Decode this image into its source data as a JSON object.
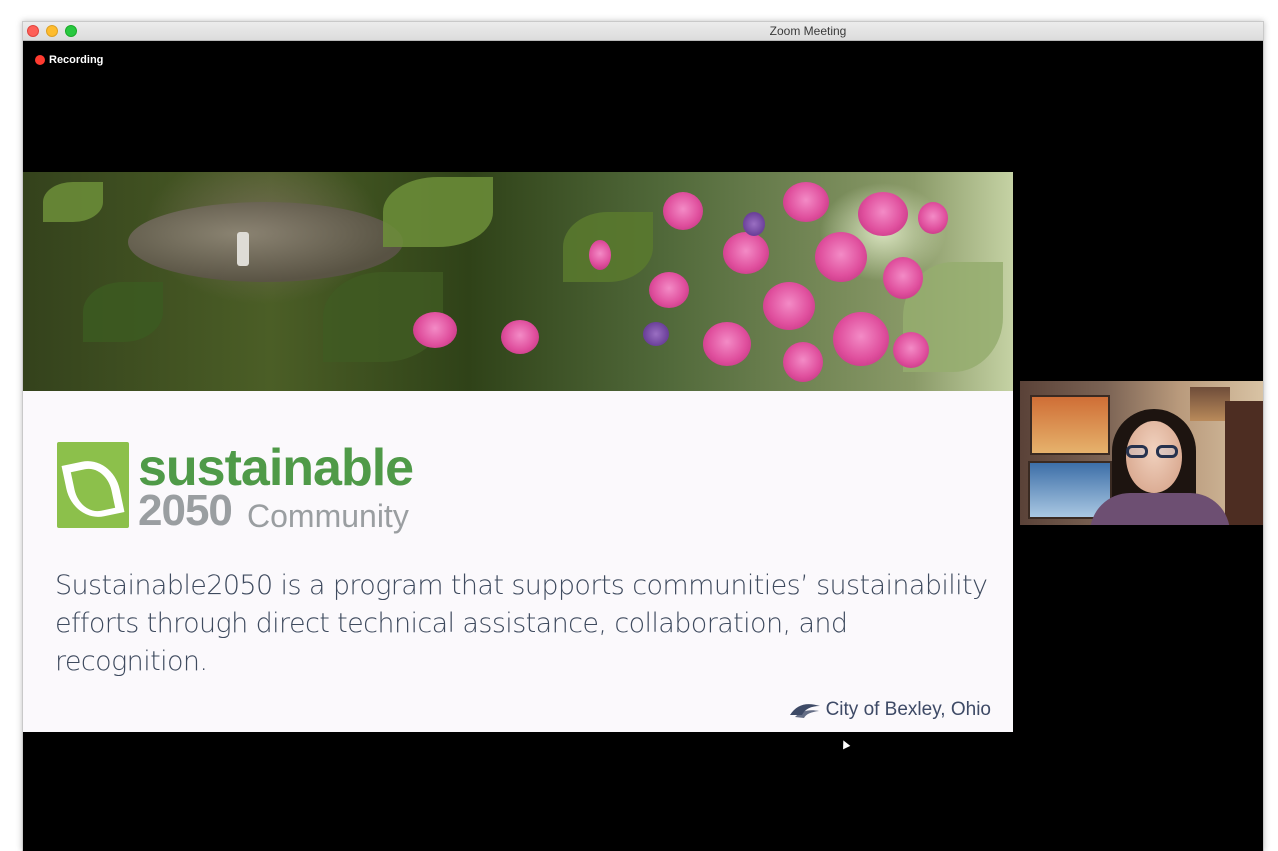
{
  "window": {
    "title": "Zoom Meeting"
  },
  "recording": {
    "label": "Recording",
    "indicator_color": "#ff3b30"
  },
  "slide": {
    "logo": {
      "line1": "sustainable",
      "line2_number": "2050",
      "line2_word": "Community"
    },
    "body": "Sustainable2050 is a program that supports communities’ sustainability efforts through direct technical assistance, collaboration, and recognition.",
    "footer": {
      "icon": "bexley-seal-icon",
      "label": "City of Bexley, Ohio"
    },
    "colors": {
      "logo_green": "#4f9a48",
      "logo_gray": "#9a9ea1",
      "leaf_green": "#8cc04b",
      "text": "#3e4a5e"
    }
  },
  "participant": {
    "video": "participant-video-tile"
  }
}
